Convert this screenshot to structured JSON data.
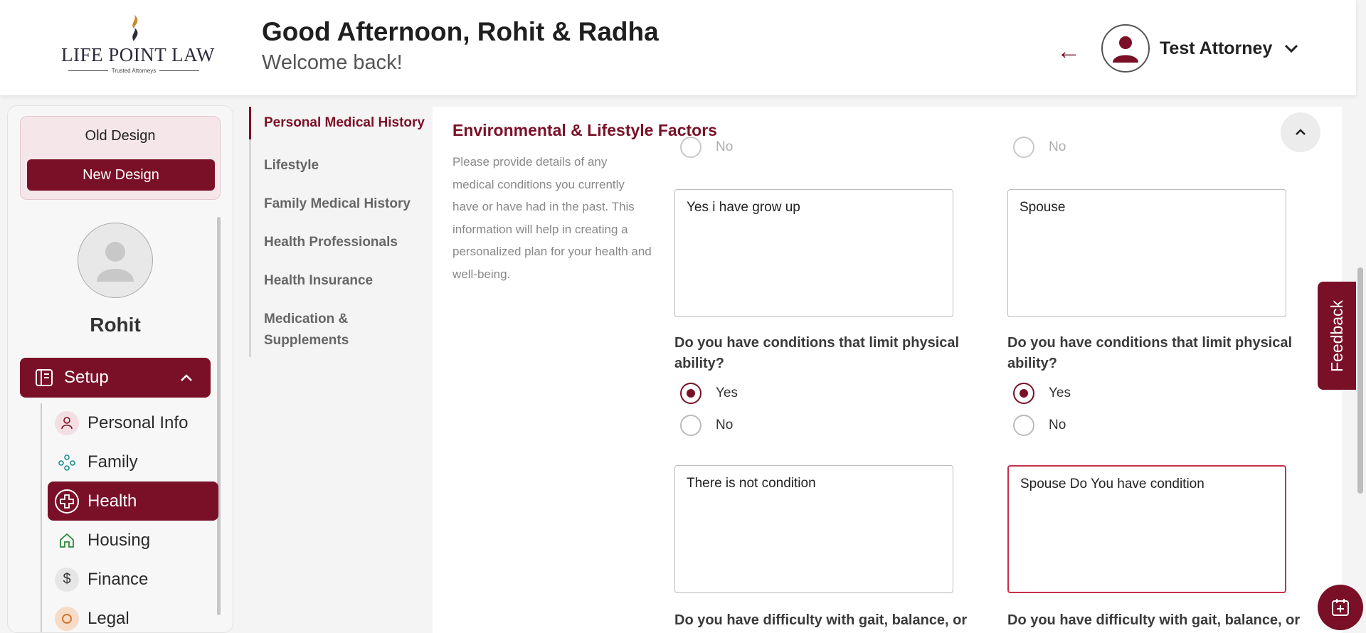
{
  "header": {
    "logo_text": "LIFE POINT LAW",
    "logo_tagline": "Trusted Attorneys",
    "greeting": "Good Afternoon, Rohit & Radha",
    "welcome": "Welcome back!",
    "user_name": "Test Attorney"
  },
  "sidebar": {
    "old_design": "Old Design",
    "new_design": "New Design",
    "profile_name": "Rohit",
    "setup_label": "Setup",
    "items": [
      {
        "label": "Personal Info",
        "icon": "person-icon"
      },
      {
        "label": "Family",
        "icon": "family-icon"
      },
      {
        "label": "Health",
        "icon": "health-cross-icon",
        "active": true
      },
      {
        "label": "Housing",
        "icon": "home-icon"
      },
      {
        "label": "Finance",
        "icon": "dollar-icon"
      },
      {
        "label": "Legal",
        "icon": "legal-icon"
      }
    ]
  },
  "subsections": [
    {
      "label": "Personal Medical History",
      "active": true
    },
    {
      "label": "Lifestyle"
    },
    {
      "label": "Family Medical History"
    },
    {
      "label": "Health Professionals"
    },
    {
      "label": "Health Insurance"
    },
    {
      "label": "Medication & Supplements"
    }
  ],
  "section": {
    "title": "Environmental & Lifestyle Factors",
    "description": "Please provide details of any medical conditions you currently have or have had in the past. This information will help in creating a personalized plan for your health and well-being."
  },
  "form": {
    "partial_option": "No",
    "left": {
      "answer1": "Yes i have grow up",
      "question2": "Do you have conditions that limit physical ability?",
      "q2_selected": "Yes",
      "answer2": "There is not condition",
      "question3": "Do you have difficulty with gait, balance, or"
    },
    "right": {
      "answer1": "Spouse",
      "question2": "Do you have conditions that limit physical ability?",
      "q2_selected": "Yes",
      "answer2": "Spouse Do You have condition",
      "question3": "Do you have difficulty with gait, balance, or"
    },
    "option_yes": "Yes",
    "option_no": "No"
  },
  "feedback_label": "Feedback",
  "colors": {
    "brand": "#7a1027",
    "focus_border": "#c9304a"
  }
}
